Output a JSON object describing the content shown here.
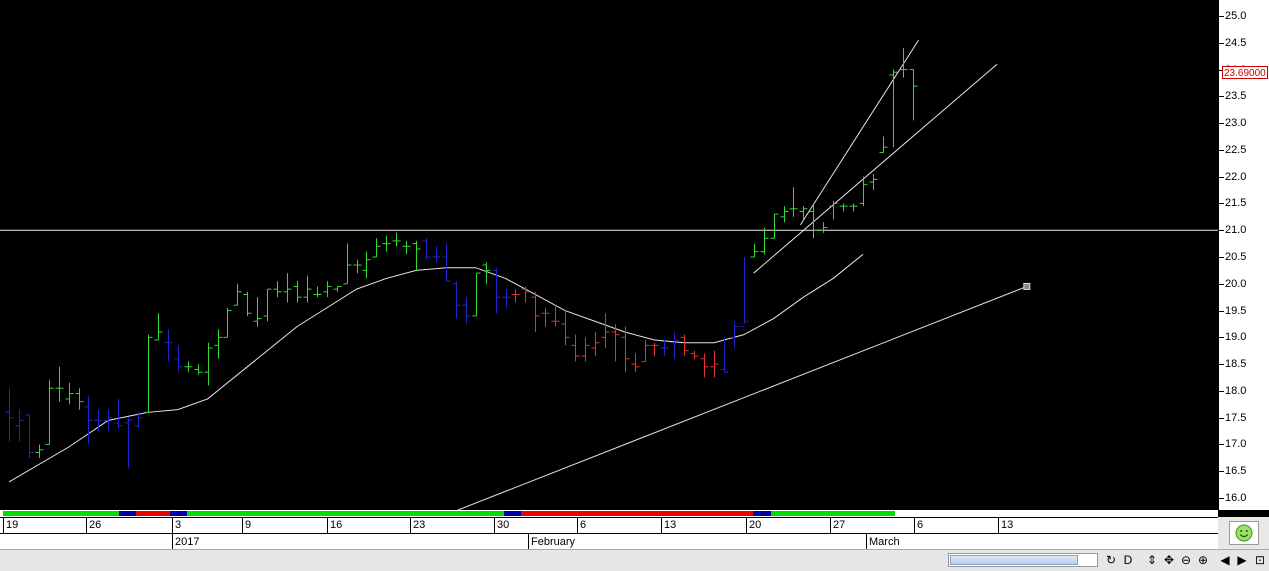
{
  "chart_data": {
    "type": "ohlc-bar",
    "ylim": [
      15.8,
      25.3
    ],
    "y_ticks": [
      "25.0",
      "24.5",
      "24.0",
      "23.5",
      "23.0",
      "22.5",
      "22.0",
      "21.5",
      "21.0",
      "20.5",
      "20.0",
      "19.5",
      "19.0",
      "18.5",
      "18.0",
      "17.5",
      "17.0",
      "16.5",
      "16.0"
    ],
    "last_price": "23.69000",
    "horizontal_line": 21.0,
    "colors": {
      "up": "#33dd33",
      "down": "#dd3333",
      "neutral": "#2222cc",
      "line": "#e6e6e6",
      "trend_green": "#00e000",
      "trend_red": "#ee0000",
      "trend_blue": "#0000aa"
    },
    "bars": [
      {
        "i": 0,
        "o": 17.6,
        "h": 18.05,
        "l": 17.05,
        "c": 17.5,
        "col": "blue"
      },
      {
        "i": 1,
        "o": 17.35,
        "h": 17.65,
        "l": 17.05,
        "c": 17.45,
        "col": "blue"
      },
      {
        "i": 2,
        "o": 17.55,
        "h": 17.55,
        "l": 16.75,
        "c": 16.85,
        "col": "blue"
      },
      {
        "i": 3,
        "o": 16.85,
        "h": 17.0,
        "l": 16.75,
        "c": 16.9,
        "col": "green"
      },
      {
        "i": 4,
        "o": 17.0,
        "h": 18.2,
        "l": 17.0,
        "c": 18.05,
        "col": "green"
      },
      {
        "i": 5,
        "o": 18.05,
        "h": 18.45,
        "l": 17.8,
        "c": 18.05,
        "col": "green"
      },
      {
        "i": 6,
        "o": 17.85,
        "h": 18.15,
        "l": 17.75,
        "c": 17.95,
        "col": "green"
      },
      {
        "i": 7,
        "o": 17.95,
        "h": 18.05,
        "l": 17.65,
        "c": 17.8,
        "col": "green"
      },
      {
        "i": 8,
        "o": 17.7,
        "h": 17.9,
        "l": 17.0,
        "c": 17.45,
        "col": "blue"
      },
      {
        "i": 9,
        "o": 17.45,
        "h": 17.65,
        "l": 17.25,
        "c": 17.45,
        "col": "blue"
      },
      {
        "i": 10,
        "o": 17.45,
        "h": 17.65,
        "l": 17.25,
        "c": 17.5,
        "col": "blue"
      },
      {
        "i": 11,
        "o": 17.4,
        "h": 17.85,
        "l": 17.3,
        "c": 17.35,
        "col": "blue"
      },
      {
        "i": 12,
        "o": 17.4,
        "h": 17.5,
        "l": 16.55,
        "c": 17.45,
        "col": "blue"
      },
      {
        "i": 13,
        "o": 17.35,
        "h": 17.6,
        "l": 17.3,
        "c": 17.5,
        "col": "blue"
      },
      {
        "i": 14,
        "o": 17.6,
        "h": 19.05,
        "l": 17.6,
        "c": 19.0,
        "col": "green"
      },
      {
        "i": 15,
        "o": 18.95,
        "h": 19.45,
        "l": 18.95,
        "c": 19.1,
        "col": "green"
      },
      {
        "i": 16,
        "o": 18.9,
        "h": 19.15,
        "l": 18.55,
        "c": 18.9,
        "col": "blue"
      },
      {
        "i": 17,
        "o": 18.6,
        "h": 18.85,
        "l": 18.35,
        "c": 18.45,
        "col": "blue"
      },
      {
        "i": 18,
        "o": 18.45,
        "h": 18.55,
        "l": 18.35,
        "c": 18.45,
        "col": "green"
      },
      {
        "i": 19,
        "o": 18.4,
        "h": 18.5,
        "l": 18.3,
        "c": 18.35,
        "col": "green"
      },
      {
        "i": 20,
        "o": 18.35,
        "h": 18.9,
        "l": 18.1,
        "c": 18.8,
        "col": "green"
      },
      {
        "i": 21,
        "o": 18.85,
        "h": 19.15,
        "l": 18.6,
        "c": 19.0,
        "col": "green"
      },
      {
        "i": 22,
        "o": 19.0,
        "h": 19.55,
        "l": 19.0,
        "c": 19.5,
        "col": "green"
      },
      {
        "i": 23,
        "o": 19.6,
        "h": 20.0,
        "l": 19.6,
        "c": 19.85,
        "col": "green"
      },
      {
        "i": 24,
        "o": 19.8,
        "h": 19.85,
        "l": 19.4,
        "c": 19.45,
        "col": "green"
      },
      {
        "i": 25,
        "o": 19.3,
        "h": 19.75,
        "l": 19.2,
        "c": 19.35,
        "col": "green"
      },
      {
        "i": 26,
        "o": 19.4,
        "h": 19.9,
        "l": 19.3,
        "c": 19.9,
        "col": "green"
      },
      {
        "i": 27,
        "o": 19.9,
        "h": 20.05,
        "l": 19.75,
        "c": 19.85,
        "col": "green"
      },
      {
        "i": 28,
        "o": 19.85,
        "h": 20.2,
        "l": 19.65,
        "c": 19.9,
        "col": "green"
      },
      {
        "i": 29,
        "o": 19.95,
        "h": 20.05,
        "l": 19.65,
        "c": 19.75,
        "col": "green"
      },
      {
        "i": 30,
        "o": 19.75,
        "h": 20.15,
        "l": 19.65,
        "c": 19.9,
        "col": "green"
      },
      {
        "i": 31,
        "o": 19.8,
        "h": 19.95,
        "l": 19.75,
        "c": 19.8,
        "col": "green"
      },
      {
        "i": 32,
        "o": 19.85,
        "h": 20.05,
        "l": 19.75,
        "c": 19.95,
        "col": "green"
      },
      {
        "i": 33,
        "o": 19.9,
        "h": 19.95,
        "l": 19.85,
        "c": 19.95,
        "col": "green"
      },
      {
        "i": 34,
        "o": 20.0,
        "h": 20.75,
        "l": 20.0,
        "c": 20.35,
        "col": "green"
      },
      {
        "i": 35,
        "o": 20.35,
        "h": 20.45,
        "l": 20.2,
        "c": 20.35,
        "col": "green"
      },
      {
        "i": 36,
        "o": 20.25,
        "h": 20.6,
        "l": 20.1,
        "c": 20.45,
        "col": "green"
      },
      {
        "i": 37,
        "o": 20.5,
        "h": 20.85,
        "l": 20.5,
        "c": 20.7,
        "col": "green"
      },
      {
        "i": 38,
        "o": 20.75,
        "h": 20.9,
        "l": 20.6,
        "c": 20.75,
        "col": "green"
      },
      {
        "i": 39,
        "o": 20.8,
        "h": 20.95,
        "l": 20.7,
        "c": 20.8,
        "col": "green"
      },
      {
        "i": 40,
        "o": 20.7,
        "h": 20.8,
        "l": 20.55,
        "c": 20.7,
        "col": "green"
      },
      {
        "i": 41,
        "o": 20.75,
        "h": 20.8,
        "l": 20.25,
        "c": 20.65,
        "col": "green"
      },
      {
        "i": 42,
        "o": 20.8,
        "h": 20.85,
        "l": 20.45,
        "c": 20.5,
        "col": "blue"
      },
      {
        "i": 43,
        "o": 20.5,
        "h": 20.7,
        "l": 20.4,
        "c": 20.5,
        "col": "blue"
      },
      {
        "i": 44,
        "o": 20.5,
        "h": 20.75,
        "l": 20.05,
        "c": 20.05,
        "col": "blue"
      },
      {
        "i": 45,
        "o": 20.0,
        "h": 20.05,
        "l": 19.35,
        "c": 19.6,
        "col": "blue"
      },
      {
        "i": 46,
        "o": 19.6,
        "h": 19.75,
        "l": 19.25,
        "c": 19.4,
        "col": "blue"
      },
      {
        "i": 47,
        "o": 19.4,
        "h": 20.2,
        "l": 19.4,
        "c": 20.2,
        "col": "green"
      },
      {
        "i": 48,
        "o": 20.35,
        "h": 20.4,
        "l": 20.0,
        "c": 20.25,
        "col": "green"
      },
      {
        "i": 49,
        "o": 20.25,
        "h": 20.3,
        "l": 19.45,
        "c": 19.75,
        "col": "blue"
      },
      {
        "i": 50,
        "o": 19.75,
        "h": 19.9,
        "l": 19.55,
        "c": 19.75,
        "col": "blue"
      },
      {
        "i": 51,
        "o": 19.8,
        "h": 19.9,
        "l": 19.65,
        "c": 19.8,
        "col": "red"
      },
      {
        "i": 52,
        "o": 19.9,
        "h": 19.95,
        "l": 19.65,
        "c": 19.85,
        "col": "red"
      },
      {
        "i": 53,
        "o": 19.75,
        "h": 19.85,
        "l": 19.1,
        "c": 19.4,
        "col": "red"
      },
      {
        "i": 54,
        "o": 19.45,
        "h": 19.55,
        "l": 19.2,
        "c": 19.45,
        "col": "red"
      },
      {
        "i": 55,
        "o": 19.3,
        "h": 19.6,
        "l": 19.2,
        "c": 19.3,
        "col": "red"
      },
      {
        "i": 56,
        "o": 19.25,
        "h": 19.5,
        "l": 18.85,
        "c": 19.0,
        "col": "red"
      },
      {
        "i": 57,
        "o": 18.85,
        "h": 19.05,
        "l": 18.55,
        "c": 18.65,
        "col": "red"
      },
      {
        "i": 58,
        "o": 18.65,
        "h": 19.0,
        "l": 18.55,
        "c": 18.85,
        "col": "red"
      },
      {
        "i": 59,
        "o": 18.8,
        "h": 19.1,
        "l": 18.65,
        "c": 18.9,
        "col": "red"
      },
      {
        "i": 60,
        "o": 19.0,
        "h": 19.45,
        "l": 18.8,
        "c": 19.1,
        "col": "red"
      },
      {
        "i": 61,
        "o": 19.1,
        "h": 19.25,
        "l": 18.55,
        "c": 19.05,
        "col": "red"
      },
      {
        "i": 62,
        "o": 19.0,
        "h": 19.2,
        "l": 18.35,
        "c": 18.6,
        "col": "red"
      },
      {
        "i": 63,
        "o": 18.5,
        "h": 18.7,
        "l": 18.35,
        "c": 18.45,
        "col": "red"
      },
      {
        "i": 64,
        "o": 18.55,
        "h": 18.95,
        "l": 18.55,
        "c": 18.85,
        "col": "red"
      },
      {
        "i": 65,
        "o": 18.85,
        "h": 18.9,
        "l": 18.65,
        "c": 18.85,
        "col": "red"
      },
      {
        "i": 66,
        "o": 18.8,
        "h": 18.95,
        "l": 18.65,
        "c": 18.8,
        "col": "blue"
      },
      {
        "i": 67,
        "o": 18.9,
        "h": 19.1,
        "l": 18.6,
        "c": 18.95,
        "col": "blue"
      },
      {
        "i": 68,
        "o": 19.0,
        "h": 19.05,
        "l": 18.65,
        "c": 18.75,
        "col": "red"
      },
      {
        "i": 69,
        "o": 18.7,
        "h": 18.75,
        "l": 18.6,
        "c": 18.65,
        "col": "red"
      },
      {
        "i": 70,
        "o": 18.6,
        "h": 18.7,
        "l": 18.25,
        "c": 18.45,
        "col": "red"
      },
      {
        "i": 71,
        "o": 18.45,
        "h": 18.75,
        "l": 18.25,
        "c": 18.5,
        "col": "red"
      },
      {
        "i": 72,
        "o": 18.4,
        "h": 19.0,
        "l": 18.35,
        "c": 18.35,
        "col": "blue"
      },
      {
        "i": 73,
        "o": 19.0,
        "h": 19.3,
        "l": 18.8,
        "c": 19.2,
        "col": "blue"
      },
      {
        "i": 74,
        "o": 19.2,
        "h": 20.5,
        "l": 19.25,
        "c": 19.3,
        "col": "blue"
      },
      {
        "i": 75,
        "o": 20.5,
        "h": 20.75,
        "l": 20.5,
        "c": 20.6,
        "col": "green"
      },
      {
        "i": 76,
        "o": 20.6,
        "h": 21.05,
        "l": 20.55,
        "c": 20.85,
        "col": "green"
      },
      {
        "i": 77,
        "o": 20.85,
        "h": 21.3,
        "l": 20.85,
        "c": 21.3,
        "col": "green"
      },
      {
        "i": 78,
        "o": 21.25,
        "h": 21.45,
        "l": 21.15,
        "c": 21.35,
        "col": "green"
      },
      {
        "i": 79,
        "o": 21.4,
        "h": 21.8,
        "l": 21.25,
        "c": 21.4,
        "col": "green"
      },
      {
        "i": 80,
        "o": 21.35,
        "h": 21.45,
        "l": 21.2,
        "c": 21.4,
        "col": "green"
      },
      {
        "i": 81,
        "o": 21.35,
        "h": 21.5,
        "l": 20.85,
        "c": 21.0,
        "col": "green"
      },
      {
        "i": 82,
        "o": 21.0,
        "h": 21.15,
        "l": 20.95,
        "c": 21.05,
        "col": "green"
      },
      {
        "i": 83,
        "o": 21.45,
        "h": 21.55,
        "l": 21.2,
        "c": 21.5,
        "col": "green"
      },
      {
        "i": 84,
        "o": 21.45,
        "h": 21.5,
        "l": 21.35,
        "c": 21.45,
        "col": "green"
      },
      {
        "i": 85,
        "o": 21.45,
        "h": 21.5,
        "l": 21.35,
        "c": 21.45,
        "col": "green"
      },
      {
        "i": 86,
        "o": 21.5,
        "h": 22.0,
        "l": 21.45,
        "c": 21.85,
        "col": "green"
      },
      {
        "i": 87,
        "o": 21.9,
        "h": 22.05,
        "l": 21.75,
        "c": 21.95,
        "col": "green"
      },
      {
        "i": 88,
        "o": 22.45,
        "h": 22.75,
        "l": 22.45,
        "c": 22.55,
        "col": "green"
      },
      {
        "i": 89,
        "o": 23.9,
        "h": 24.0,
        "l": 22.55,
        "c": 23.95,
        "col": "green"
      },
      {
        "i": 90,
        "o": 24.0,
        "h": 24.4,
        "l": 23.85,
        "c": 24.0,
        "col": "green"
      },
      {
        "i": 91,
        "o": 24.0,
        "h": 24.0,
        "l": 23.05,
        "c": 23.69,
        "col": "green"
      }
    ],
    "moving_average": [
      [
        0,
        16.3
      ],
      [
        6,
        16.95
      ],
      [
        10,
        17.45
      ],
      [
        14,
        17.6
      ],
      [
        17,
        17.65
      ],
      [
        20,
        17.85
      ],
      [
        23,
        18.3
      ],
      [
        26,
        18.75
      ],
      [
        29,
        19.2
      ],
      [
        32,
        19.55
      ],
      [
        35,
        19.9
      ],
      [
        38,
        20.1
      ],
      [
        41,
        20.25
      ],
      [
        44,
        20.3
      ],
      [
        47,
        20.3
      ],
      [
        50,
        20.1
      ],
      [
        53,
        19.8
      ],
      [
        56,
        19.5
      ],
      [
        59,
        19.3
      ],
      [
        62,
        19.1
      ],
      [
        65,
        18.95
      ],
      [
        68,
        18.9
      ],
      [
        71,
        18.9
      ],
      [
        74,
        19.05
      ],
      [
        77,
        19.35
      ],
      [
        80,
        19.75
      ],
      [
        83,
        20.1
      ],
      [
        86,
        20.55
      ]
    ],
    "trendlines": [
      {
        "x1": 38,
        "y1": 15.25,
        "x2": 102.5,
        "y2": 19.95,
        "handle": true
      },
      {
        "x1": 75,
        "y1": 20.2,
        "x2": 99.5,
        "y2": 24.1
      },
      {
        "x1": 79.7,
        "y1": 21.1,
        "x2": 91.6,
        "y2": 24.55
      }
    ],
    "trend_strip": [
      {
        "from": 0,
        "to": 11.7,
        "color": "green"
      },
      {
        "from": 11.7,
        "to": 13.4,
        "color": "blue"
      },
      {
        "from": 13.4,
        "to": 16.8,
        "color": "red"
      },
      {
        "from": 16.8,
        "to": 18.5,
        "color": "blue"
      },
      {
        "from": 18.5,
        "to": 50.5,
        "color": "green"
      },
      {
        "from": 50.5,
        "to": 52.2,
        "color": "blue"
      },
      {
        "from": 52.2,
        "to": 75.5,
        "color": "red"
      },
      {
        "from": 75.5,
        "to": 77.3,
        "color": "blue"
      },
      {
        "from": 77.3,
        "to": 89.8,
        "color": "green"
      }
    ],
    "day_labels": [
      {
        "x": 0,
        "label": "19"
      },
      {
        "x": 8.4,
        "label": "26"
      },
      {
        "x": 17,
        "label": "3"
      },
      {
        "x": 24.1,
        "label": "9"
      },
      {
        "x": 32.6,
        "label": "16"
      },
      {
        "x": 41,
        "label": "23"
      },
      {
        "x": 49.4,
        "label": "30"
      },
      {
        "x": 57.8,
        "label": "6"
      },
      {
        "x": 66.3,
        "label": "13"
      },
      {
        "x": 74.8,
        "label": "20"
      },
      {
        "x": 83.3,
        "label": "27"
      },
      {
        "x": 91.7,
        "label": "6"
      },
      {
        "x": 100.2,
        "label": "13"
      }
    ],
    "month_labels": [
      {
        "x": 17,
        "label": "2017"
      },
      {
        "x": 52.9,
        "label": "February"
      },
      {
        "x": 86.9,
        "label": "March"
      }
    ]
  },
  "toolbar": {
    "icons": [
      "refresh-icon",
      "d-icon",
      "vertical-move-icon",
      "pan-icon",
      "zoom-out-icon",
      "zoom-in-icon",
      "scroll-left-icon",
      "scroll-right-icon",
      "maximize-icon"
    ],
    "glyphs": [
      "↻",
      "D",
      "⇕",
      "✥",
      "⊖",
      "⊕",
      "◀",
      "▶",
      "⊡"
    ]
  }
}
